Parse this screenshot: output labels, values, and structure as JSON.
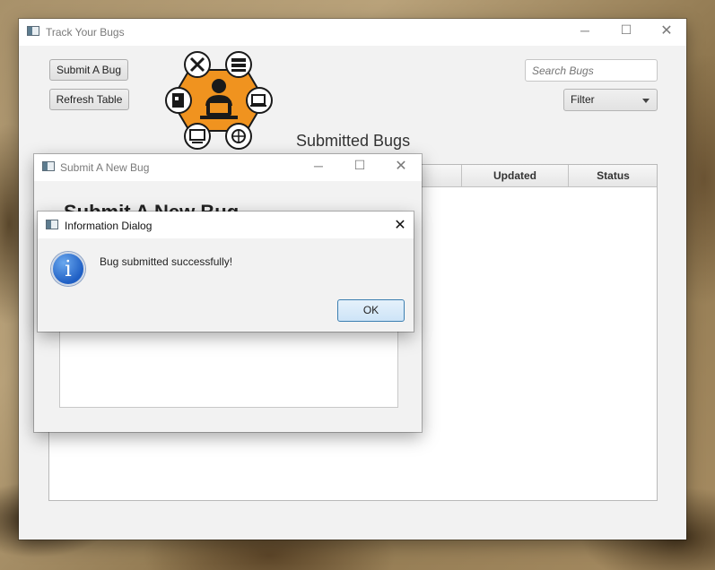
{
  "main_window": {
    "title": "Track Your Bugs",
    "submit_button": "Submit A Bug",
    "refresh_button": "Refresh Table",
    "search_placeholder": "Search Bugs",
    "filter_label": "Filter",
    "heading": "Submitted Bugs",
    "table": {
      "columns": [
        "ed",
        "Updated",
        "Status"
      ]
    }
  },
  "submit_window": {
    "title": "Submit A New Bug",
    "heading": "Submit A New Bug"
  },
  "dialog": {
    "title": "Information Dialog",
    "icon": "info-icon",
    "message": "Bug submitted successfully!",
    "ok_button": "OK"
  },
  "colors": {
    "logo_orange": "#f0931f",
    "dialog_button_border": "#3c7fb1",
    "info_blue": "#1f5fc4"
  }
}
